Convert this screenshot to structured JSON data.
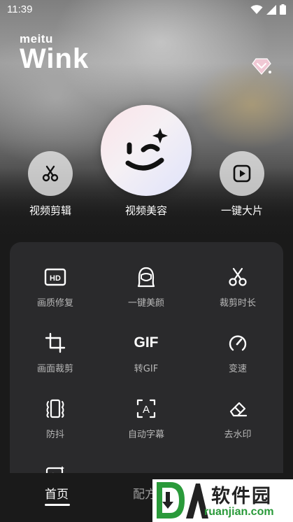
{
  "status_bar": {
    "time": "11:39"
  },
  "logo": {
    "small": "meitu",
    "big": "Wink"
  },
  "hero": {
    "left_label": "视频剪辑",
    "center_label": "视频美容",
    "right_label": "一键大片"
  },
  "tools": [
    {
      "label": "画质修复",
      "icon": "hd-icon"
    },
    {
      "label": "一键美颜",
      "icon": "face-icon"
    },
    {
      "label": "裁剪时长",
      "icon": "scissors-icon"
    },
    {
      "label": "画面裁剪",
      "icon": "crop-icon"
    },
    {
      "label": "转GIF",
      "icon": "gif-icon",
      "icon_text": "GIF"
    },
    {
      "label": "变速",
      "icon": "speedometer-icon"
    },
    {
      "label": "防抖",
      "icon": "stabilize-icon"
    },
    {
      "label": "自动字幕",
      "icon": "subtitle-icon",
      "icon_text": "A"
    },
    {
      "label": "去水印",
      "icon": "eraser-icon"
    }
  ],
  "bottom_nav": {
    "home": "首页",
    "recipes": "配方"
  },
  "watermark": {
    "cn": "软件园",
    "en": "ruanjian.com"
  },
  "colors": {
    "panel": "#2a2a2c",
    "background": "#1a1a1a",
    "label": "#b8b8b8",
    "accent_green": "#2a9a3a"
  }
}
